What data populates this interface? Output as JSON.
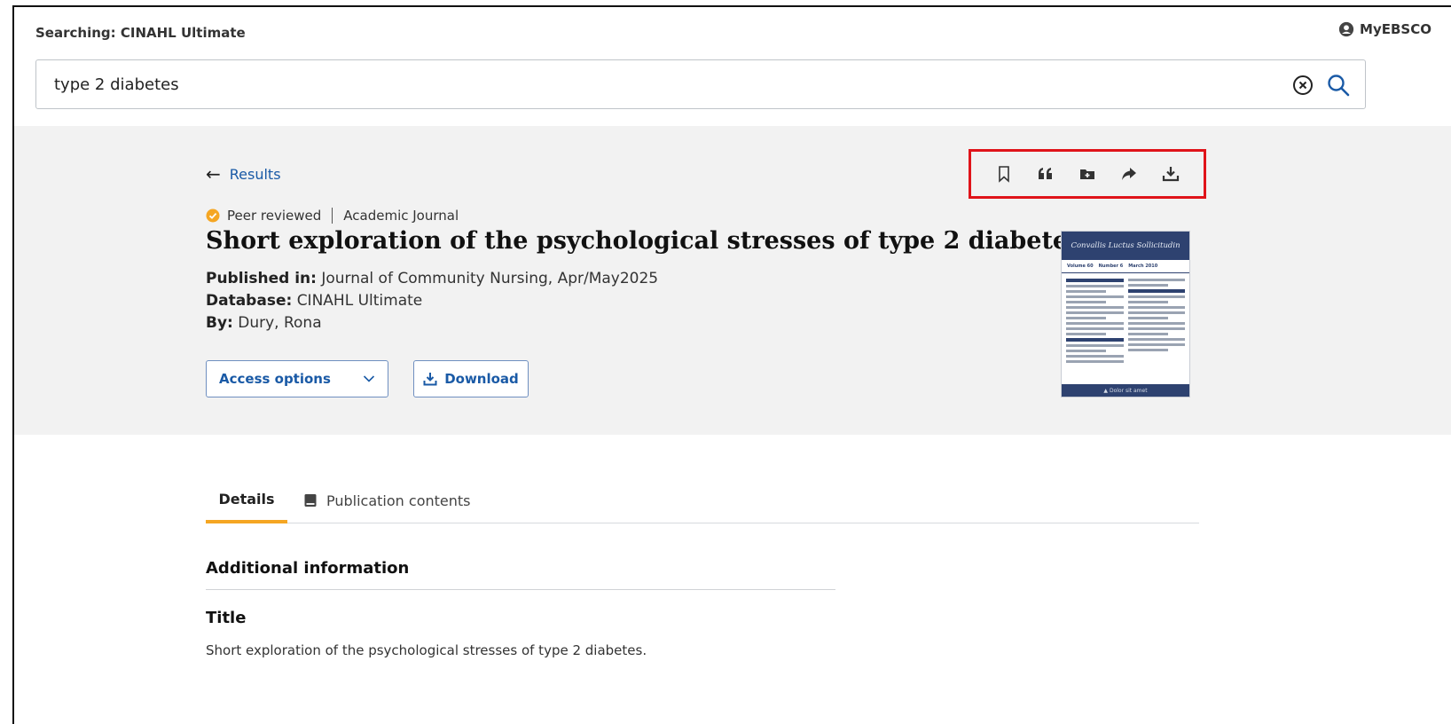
{
  "header": {
    "searching_label": "Searching:",
    "database": "CINAHL Ultimate",
    "account_label": "MyEBSCO"
  },
  "search": {
    "query": "type 2 diabetes",
    "placeholder": ""
  },
  "nav": {
    "back_label": "Results"
  },
  "toolbar": {
    "icons": [
      "bookmark-icon",
      "cite-icon",
      "add-to-folder-icon",
      "share-icon",
      "download-icon"
    ],
    "highlight_color": "#e0141a"
  },
  "article": {
    "peer_label": "Peer reviewed",
    "type_label": "Academic Journal",
    "title": "Short exploration of the psychological stresses of type 2 diabetes.",
    "published_label": "Published in:",
    "published_value": "Journal of Community Nursing, Apr/May2025",
    "database_label": "Database:",
    "database_value": "CINAHL Ultimate",
    "by_label": "By:",
    "by_value": "Dury, Rona"
  },
  "actions": {
    "access_label": "Access options",
    "download_label": "Download"
  },
  "tabs": [
    {
      "label": "Details",
      "active": true
    },
    {
      "label": "Publication contents",
      "active": false
    }
  ],
  "details": {
    "section_title": "Additional information",
    "title_label": "Title",
    "title_value": "Short exploration of the psychological stresses of type 2 diabetes."
  },
  "colors": {
    "link": "#1a5aa6",
    "active_tab": "#f5a623",
    "hero_bg": "#f2f2f2",
    "peer_badge": "#f5a623"
  }
}
